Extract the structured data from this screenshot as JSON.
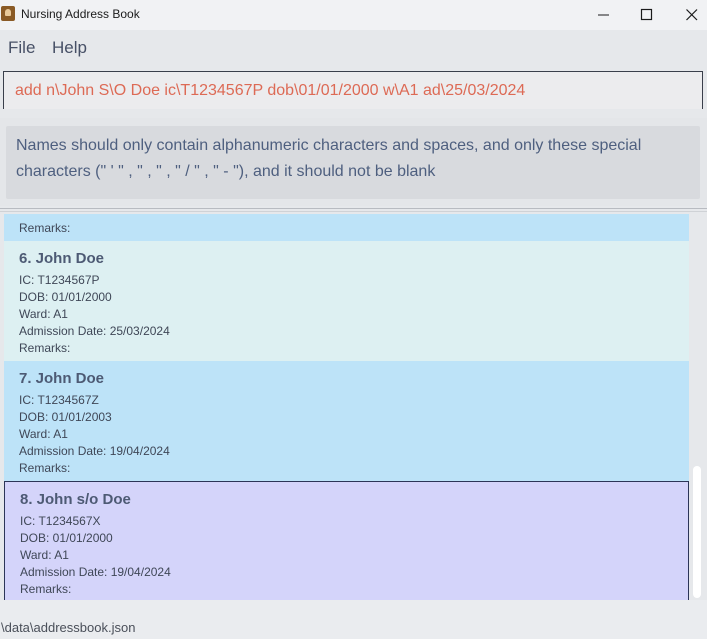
{
  "window": {
    "title": "Nursing Address Book",
    "icon": "address-book-icon",
    "controls": [
      "minimize-icon",
      "maximize-icon",
      "close-icon"
    ]
  },
  "menu": {
    "file": "File",
    "help": "Help"
  },
  "command": {
    "value": "add n\\John S\\O Doe ic\\T1234567P dob\\01/01/2000 w\\A1 ad\\25/03/2024"
  },
  "result": {
    "line1": "Names should only contain alphanumeric characters and spaces, and only these special",
    "line2": "characters (\" ' \"  ,  \" , \"  ,  \" / \"  ,  \" - \"), and it should not be blank"
  },
  "patients": {
    "partial": {
      "remarks": "Remarks:"
    },
    "items": [
      {
        "title": "6.  John Doe",
        "ic": "IC: T1234567P",
        "dob": "DOB: 01/01/2000",
        "ward": "Ward: A1",
        "admission": "Admission Date: 25/03/2024",
        "remarks": "Remarks:"
      },
      {
        "title": "7.  John Doe",
        "ic": "IC: T1234567Z",
        "dob": "DOB: 01/01/2003",
        "ward": "Ward: A1",
        "admission": "Admission Date: 19/04/2024",
        "remarks": "Remarks:"
      },
      {
        "title": "8.  John s/o Doe",
        "ic": "IC: T1234567X",
        "dob": "DOB: 01/01/2000",
        "ward": "Ward: A1",
        "admission": "Admission Date: 19/04/2024",
        "remarks": "Remarks:"
      }
    ],
    "selected_index": 2
  },
  "status": {
    "path": "\\data\\addressbook.json"
  },
  "colors": {
    "command_text": "#dd6a55",
    "card_blue": "#bde3f8",
    "card_mint": "#ddf0f2",
    "card_selected": "#d4d4fa",
    "result_text": "#4e5f7f"
  }
}
